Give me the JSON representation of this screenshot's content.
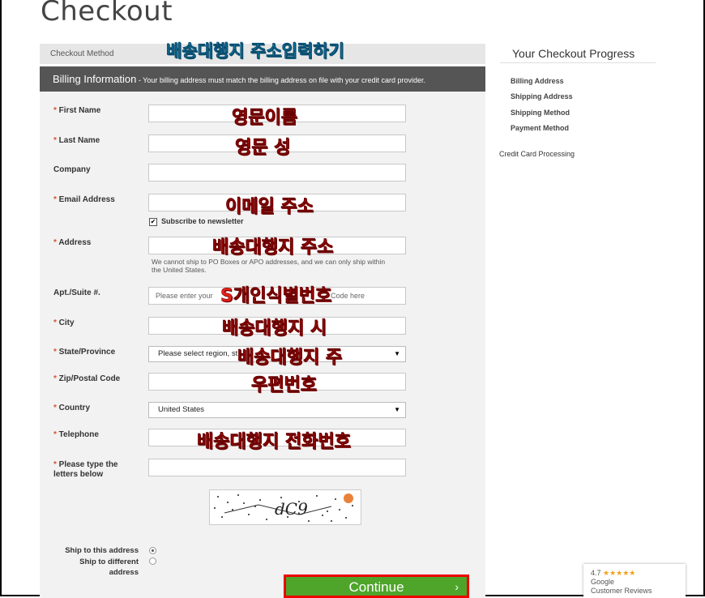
{
  "page": {
    "title": "Checkout"
  },
  "steps": {
    "checkout_method": "Checkout Method"
  },
  "billing": {
    "title": "Billing Information",
    "subtitle": " - Your billing address must match the billing address on file with your credit card provider."
  },
  "fields": {
    "first_name": {
      "label": "First Name",
      "required": "* "
    },
    "last_name": {
      "label": "Last Name",
      "required": "* "
    },
    "company": {
      "label": "Company"
    },
    "email": {
      "label": "Email Address",
      "required": "* "
    },
    "newsletter": {
      "label": "Subscribe to newsletter",
      "mark": "✔"
    },
    "address": {
      "label": "Address",
      "required": "* ",
      "note": "We cannot ship to PO Boxes or APO addresses, and we can only ship within the United States."
    },
    "apt": {
      "label": "Apt./Suite #.",
      "placeholder": "Please enter your ",
      "placeholder_tail": "Code here"
    },
    "city": {
      "label": "City",
      "required": "* "
    },
    "state": {
      "label": "State/Province",
      "required": "* ",
      "value": "Please select region, st"
    },
    "zip": {
      "label": "Zip/Postal Code",
      "required": "* "
    },
    "country": {
      "label": "Country",
      "required": "* ",
      "value": "United States"
    },
    "telephone": {
      "label": "Telephone",
      "required": "* "
    },
    "captcha": {
      "label": "Please type the letters below",
      "required": "* "
    }
  },
  "shipping_options": {
    "this_address": "Ship to this address",
    "different_address": "Ship to different address"
  },
  "continue_button": {
    "label": "Continue",
    "chevron": "›"
  },
  "progress": {
    "title": "Your Checkout Progress",
    "items": [
      "Billing Address",
      "Shipping Address",
      "Shipping Method",
      "Payment Method"
    ],
    "credit_card": "Credit Card Processing"
  },
  "reviews": {
    "rating": "4.7",
    "stars": "★★★★★",
    "line1": "Google",
    "line2": "Customer Reviews"
  },
  "annotations": {
    "header": "배송대행지 주소입력하기",
    "first_name": "영문이름",
    "last_name": "영문 성",
    "email": "이메일 주소",
    "address": "배송대행지 주소",
    "apt": "S개인식별번호",
    "city": "배송대행지 시",
    "state": "배송대행지 주",
    "zip": "우편번호",
    "telephone": "배송대행지 전화번호"
  },
  "colors": {
    "accent_green": "#4ea52a",
    "required_star": "#e0512c",
    "annotation_red": "#e8201a",
    "annotation_blue": "#24b8e6"
  }
}
